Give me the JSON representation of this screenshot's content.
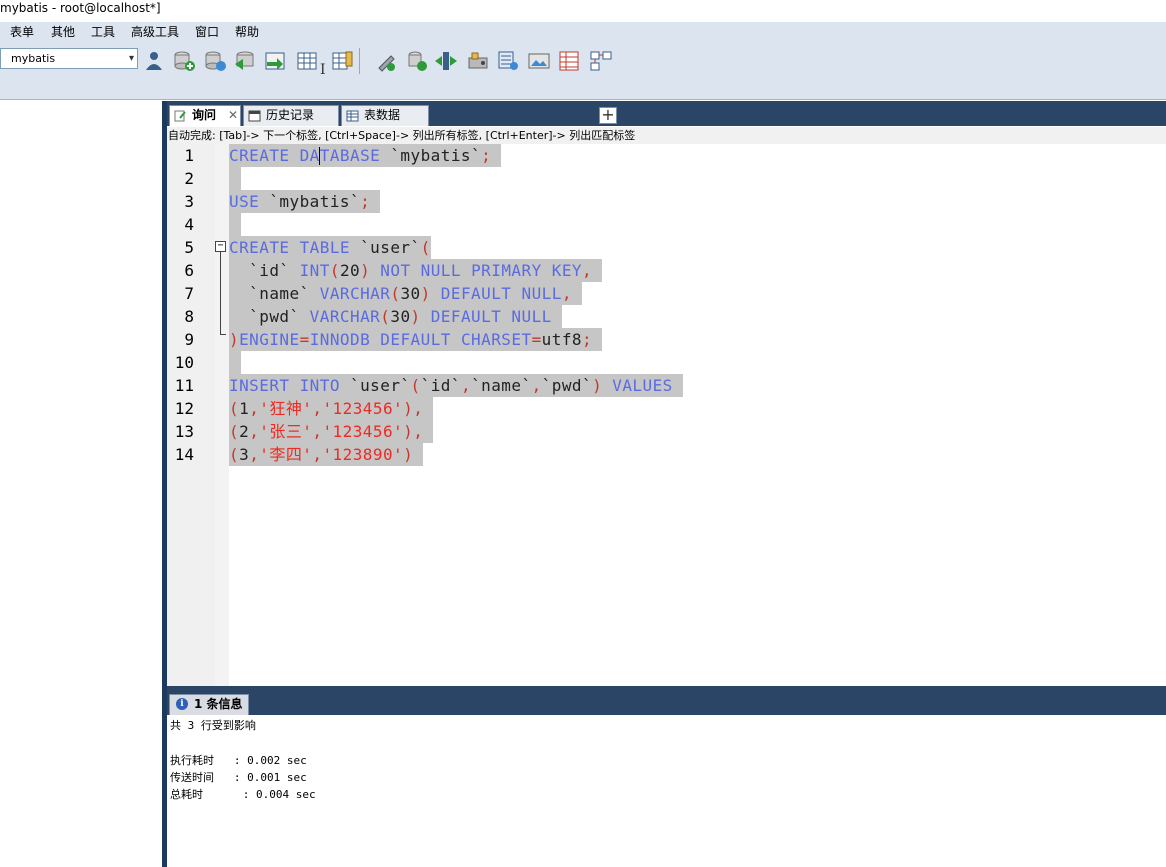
{
  "window": {
    "title": "mybatis - root@localhost*]"
  },
  "menu": {
    "items": [
      "表单",
      "其他",
      "工具",
      "高级工具",
      "窗口",
      "帮助"
    ]
  },
  "toolbar": {
    "database_select": "mybatis",
    "icons": [
      "user-icon",
      "db-add-icon",
      "db-copy-icon",
      "db-refresh-icon",
      "import-icon",
      "table-icon",
      "table-edit-icon",
      "wrench-icon",
      "db-backup-icon",
      "sync-icon",
      "server-icon",
      "schema-icon",
      "image-icon",
      "report-icon",
      "designer-icon"
    ]
  },
  "tabs": [
    {
      "label": "询问",
      "close": "✕"
    },
    {
      "label": "历史记录"
    },
    {
      "label": "表数据"
    }
  ],
  "tab_add": "+",
  "autocomplete_hint": "自动完成: [Tab]-> 下一个标签, [Ctrl+Space]-> 列出所有标签, [Ctrl+Enter]-> 列出匹配标签",
  "editor": {
    "line_numbers": [
      "1",
      "2",
      "3",
      "4",
      "5",
      "6",
      "7",
      "8",
      "9",
      "10",
      "11",
      "12",
      "13",
      "14"
    ],
    "fold_marker": "−",
    "lines": {
      "l1": [
        "CREATE",
        " ",
        "DATABASE",
        " `mybatis`",
        ";"
      ],
      "l3": [
        "USE",
        " `mybatis`",
        ";"
      ],
      "l5": [
        "CREATE",
        " ",
        "TABLE",
        " `user`",
        "("
      ],
      "l6": [
        "  `id` ",
        "INT",
        "(",
        "20",
        ")",
        " ",
        "NOT",
        " ",
        "NULL",
        " ",
        "PRIMARY",
        " ",
        "KEY",
        ","
      ],
      "l7": [
        "  `name` ",
        "VARCHAR",
        "(",
        "30",
        ")",
        " ",
        "DEFAULT",
        " ",
        "NULL",
        ","
      ],
      "l8": [
        "  `pwd` ",
        "VARCHAR",
        "(",
        "30",
        ")",
        " ",
        "DEFAULT",
        " ",
        "NULL"
      ],
      "l9": [
        ")",
        "ENGINE",
        "=",
        "INNODB",
        " ",
        "DEFAULT",
        " ",
        "CHARSET",
        "=",
        "utf8",
        ";"
      ],
      "l11": [
        "INSERT",
        " ",
        "INTO",
        " `user`",
        "(",
        "`id`",
        ",",
        "`name`",
        ",",
        "`pwd`",
        ")",
        " ",
        "VALUES"
      ],
      "l12": [
        "(",
        "1",
        ",",
        "'狂神'",
        ",",
        "'123456'",
        ")",
        ","
      ],
      "l13": [
        "(",
        "2",
        ",",
        "'张三'",
        ",",
        "'123456'",
        ")",
        ","
      ],
      "l14": [
        "(",
        "3",
        ",",
        "'李四'",
        ",",
        "'123890'",
        ")"
      ]
    }
  },
  "messages": {
    "tab_label": "1 条信息",
    "info_glyph": "i",
    "lines": [
      "共 3 行受到影响",
      "执行耗时   : 0.002 sec",
      "传送时间   : 0.001 sec",
      "总耗时      : 0.004 sec"
    ]
  }
}
